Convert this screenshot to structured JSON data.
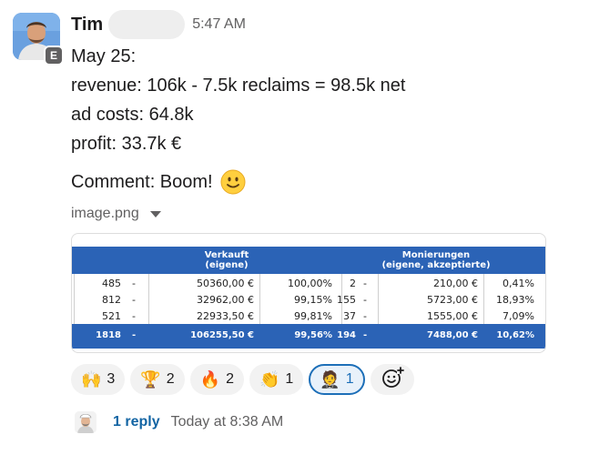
{
  "message": {
    "sender": "Tim",
    "external_badge": "E",
    "time": "5:47 AM",
    "lines": [
      "May 25:",
      "revenue: 106k - 7.5k reclaims = 98.5k net",
      "ad costs: 64.8k",
      "profit: 33.7k €"
    ],
    "comment": "Comment: Boom!",
    "file_name": "image.png"
  },
  "image_table": {
    "header_left": "Verkauft",
    "header_left_sub": "(eigene)",
    "header_right": "Monierungen",
    "header_right_sub": "(eigene, akzeptierte)",
    "rows": [
      {
        "count": "485",
        "dash": "-",
        "amount": "50360,00 €",
        "pct": "100,00%",
        "m_count": "2",
        "m_dash": "-",
        "m_amount": "210,00 €",
        "m_pct": "0,41%"
      },
      {
        "count": "812",
        "dash": "-",
        "amount": "32962,00 €",
        "pct": "99,15%",
        "m_count": "155",
        "m_dash": "-",
        "m_amount": "5723,00 €",
        "m_pct": "18,93%"
      },
      {
        "count": "521",
        "dash": "-",
        "amount": "22933,50 €",
        "pct": "99,81%",
        "m_count": "37",
        "m_dash": "-",
        "m_amount": "1555,00 €",
        "m_pct": "7,09%"
      }
    ],
    "total": {
      "count": "1818",
      "dash": "-",
      "amount": "106255,50 €",
      "pct": "99,56%",
      "m_count": "194",
      "m_dash": "-",
      "m_amount": "7488,00 €",
      "m_pct": "10,62%"
    }
  },
  "reactions": [
    {
      "emoji": "🙌",
      "count": "3",
      "icon": "raised-hands-icon"
    },
    {
      "emoji": "🏆",
      "count": "2",
      "icon": "trophy-icon"
    },
    {
      "emoji": "🔥",
      "count": "2",
      "icon": "fire-icon"
    },
    {
      "emoji": "👏",
      "count": "1",
      "icon": "clapping-hands-icon"
    },
    {
      "emoji": "🤵",
      "count": "1",
      "icon": "custom-person-icon"
    }
  ],
  "thread": {
    "reply_count": "1 reply",
    "reply_time": "Today at 8:38 AM"
  },
  "colors": {
    "link": "#1264a3",
    "table_header": "#2b63b6",
    "active_reaction": "#1d6fb8"
  }
}
